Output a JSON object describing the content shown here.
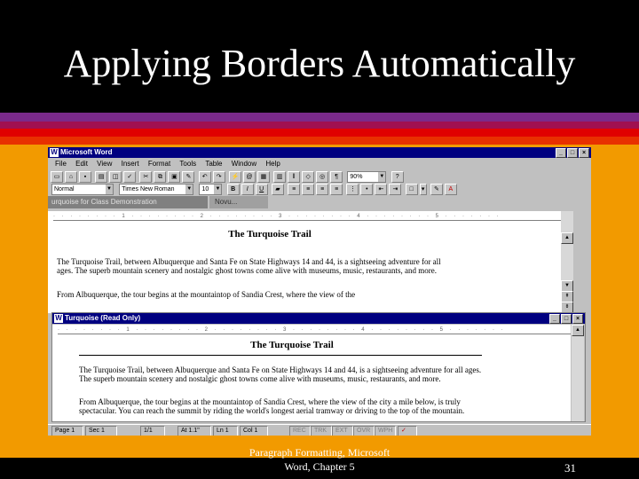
{
  "slide": {
    "title": "Applying Borders Automatically",
    "footer_line1": "Paragraph Formatting, Microsoft",
    "footer_line2": "Word, Chapter 5",
    "page_number": "31",
    "colors": {
      "background": "#000000",
      "stripe1": "#7a2a8a",
      "stripe2": "#a01050",
      "stripe3": "#e00000",
      "stripe4": "#e83000",
      "panel": "#f29a00"
    }
  },
  "word": {
    "title": "Microsoft Word",
    "menu": [
      "File",
      "Edit",
      "View",
      "Insert",
      "Format",
      "Tools",
      "Table",
      "Window",
      "Help"
    ],
    "zoom": "90%",
    "style": "Normal",
    "font": "Times New Roman",
    "size": "10",
    "tab_doc": "urquoise for Class Demonstration",
    "tab_other": "Novu...",
    "doc1": {
      "heading": "The Turquoise Trail",
      "para1": "The Turquoise Trail, between Albuquerque and Santa Fe on State Highways 14 and 44, is a sightseeing adventure for all ages. The superb mountain scenery and nostalgic ghost towns come alive with museums, music, restaurants, and more.",
      "para2": "From Albuquerque, the tour begins at the mountaintop of Sandia Crest, where the view of the"
    },
    "doc2": {
      "window_title": "Turquoise (Read Only)",
      "heading": "The Turquoise Trail",
      "para1": "The Turquoise Trail, between Albuquerque and Santa Fe on State Highways 14 and 44, is a sightseeing adventure for all ages. The superb mountain scenery and nostalgic ghost towns come alive with museums, music, restaurants, and more.",
      "para2": "From Albuquerque, the tour begins at the mountaintop of Sandia Crest, where the view of the city a mile below, is truly spectacular. You can reach the summit by riding the world's longest aerial tramway or driving to the top of the mountain."
    },
    "status": {
      "page": "Page 1",
      "sec": "Sec 1",
      "pages": "1/1",
      "at": "At 1.1\"",
      "ln": "Ln 1",
      "col": "Col 1",
      "rec": "REC",
      "trk": "TRK",
      "ext": "EXT",
      "ovr": "OVR",
      "wph": "WPH"
    }
  }
}
